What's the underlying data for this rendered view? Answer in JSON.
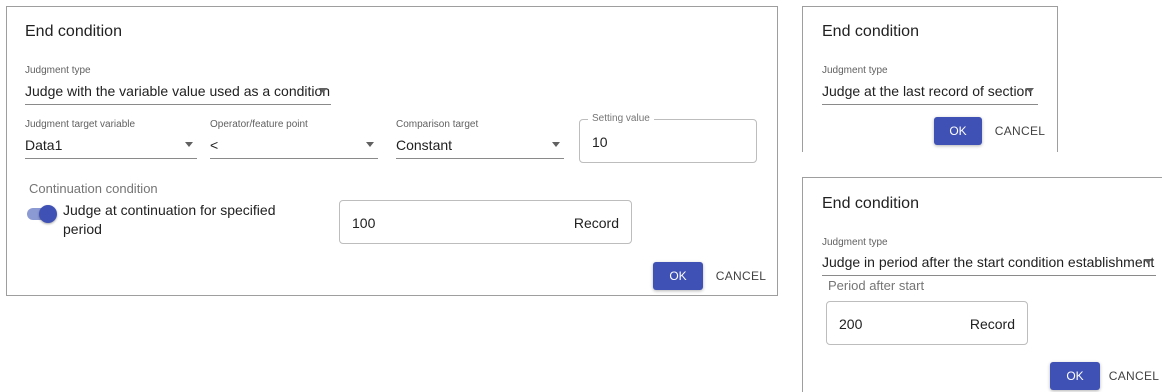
{
  "dialogs": {
    "main": {
      "title": "End condition",
      "judgment_type_label": "Judgment type",
      "judgment_type_value": "Judge with the variable value used as a condition",
      "target_variable_label": "Judgment target variable",
      "target_variable_value": "Data1",
      "operator_label": "Operator/feature point",
      "operator_value": "<",
      "comparison_label": "Comparison target",
      "comparison_value": "Constant",
      "setting_value_label": "Setting value",
      "setting_value": "10",
      "continuation_label": "Continuation condition",
      "switch_text": "Judge at continuation for specified period",
      "switch_on": true,
      "period_value": "100",
      "period_unit": "Record",
      "ok_label": "OK",
      "cancel_label": "CANCEL"
    },
    "last_record": {
      "title": "End condition",
      "judgment_type_label": "Judgment type",
      "judgment_type_value": "Judge at the last record of section",
      "ok_label": "OK",
      "cancel_label": "CANCEL"
    },
    "after_start": {
      "title": "End condition",
      "judgment_type_label": "Judgment type",
      "judgment_type_value": "Judge in period after the start condition establishment",
      "period_after_start_label": "Period after start",
      "period_value": "200",
      "period_unit": "Record",
      "ok_label": "OK",
      "cancel_label": "CANCEL"
    }
  },
  "colors": {
    "primary": "#3f51b5",
    "switch_track": "#8c9ad4",
    "border": "#9e9e9e"
  }
}
